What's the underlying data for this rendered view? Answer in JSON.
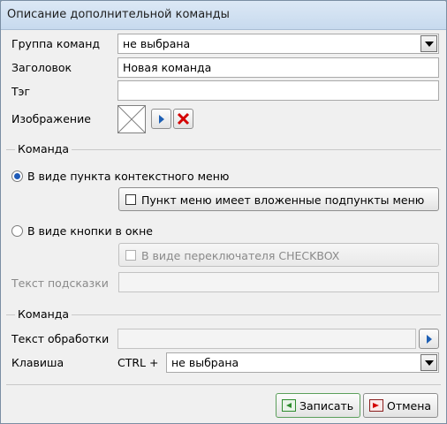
{
  "window": {
    "title": "Описание дополнительной команды"
  },
  "form": {
    "group_label": "Группа команд",
    "group_value": "не выбрана",
    "title_label": "Заголовок",
    "title_value": "Новая команда",
    "tag_label": "Тэг",
    "tag_value": "",
    "image_label": "Изображение",
    "section1_label": "Команда",
    "radio_context_label": "В виде пункта контекстного меню",
    "radio_context_selected": true,
    "submenu_check_label": "Пункт меню имеет вложенные подпункты меню",
    "radio_button_label": "В виде кнопки в окне",
    "radio_button_selected": false,
    "checkbox_toggle_label": "В виде переключателя CHECKBOX",
    "tooltip_label": "Текст подсказки",
    "tooltip_value": "",
    "section2_label": "Команда",
    "handler_label": "Текст обработки",
    "handler_value": "",
    "key_label": "Клавиша",
    "key_prefix": "CTRL +",
    "key_value": "не выбрана"
  },
  "buttons": {
    "save": "Записать",
    "cancel": "Отмена"
  },
  "colors": {
    "accent": "#1f5bb8",
    "delete_red": "#d40000",
    "save_green": "#2e8b2e"
  }
}
